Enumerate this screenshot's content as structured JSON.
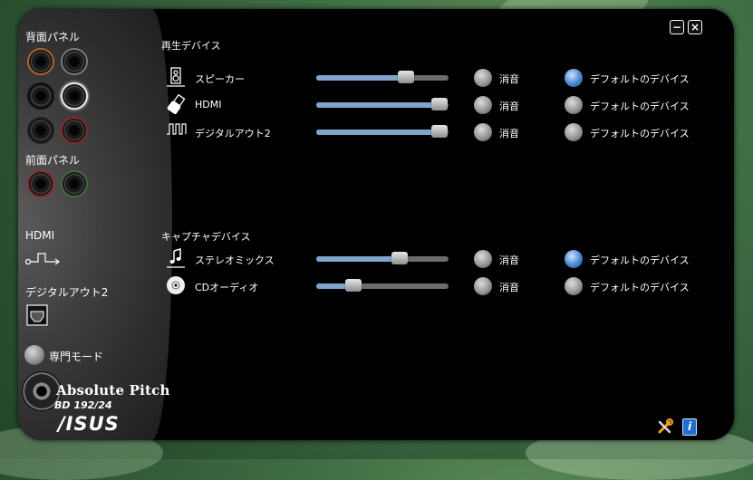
{
  "sidebar": {
    "rear_panel_title": "背面パネル",
    "front_panel_title": "前面パネル",
    "hdmi_title": "HDMI",
    "digital_out_title": "デジタルアウト2",
    "expert_mode_label": "専門モード"
  },
  "brand": {
    "product": "Absolute Pitch",
    "model": "BD 192/24",
    "logo": "/ISUS"
  },
  "window": {
    "minimize_icon": "minimize-icon",
    "close_icon": "close-icon"
  },
  "playback": {
    "title": "再生デバイス",
    "rows": [
      {
        "label": "スピーカー",
        "icon": "speaker-icon",
        "volume": 0.68,
        "mute_label": "消音",
        "default_label": "デフォルトのデバイス",
        "default_selected": true
      },
      {
        "label": "HDMI",
        "icon": "hdmi-plug-icon",
        "volume": 0.93,
        "mute_label": "消音",
        "default_label": "デフォルトのデバイス",
        "default_selected": false
      },
      {
        "label": "デジタルアウト2",
        "icon": "digital-wave-icon",
        "volume": 0.93,
        "mute_label": "消音",
        "default_label": "デフォルトのデバイス",
        "default_selected": false
      }
    ]
  },
  "capture": {
    "title": "キャプチャデバイス",
    "rows": [
      {
        "label": "ステレオミックス",
        "icon": "music-note-icon",
        "volume": 0.63,
        "mute_label": "消音",
        "default_label": "デフォルトのデバイス",
        "default_selected": true
      },
      {
        "label": "CDオーディオ",
        "icon": "cd-icon",
        "volume": 0.28,
        "mute_label": "消音",
        "default_label": "デフォルトのデバイス",
        "default_selected": false
      }
    ]
  },
  "colors": {
    "accent": "#4a86d0",
    "slider_fill": "#7fa5cc",
    "window_bg": "#000000"
  }
}
